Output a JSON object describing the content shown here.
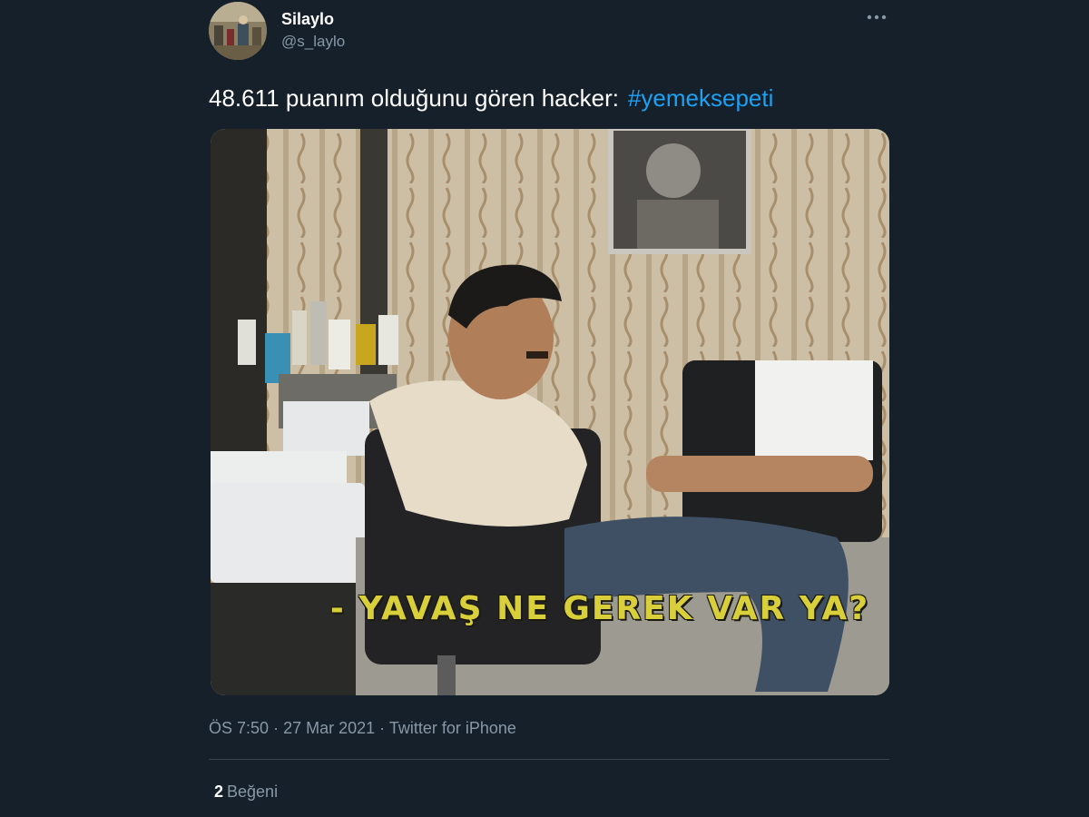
{
  "tweet": {
    "author": {
      "display_name": "Silaylo",
      "handle": "@s_laylo",
      "avatar_icon": "user-avatar-photo"
    },
    "more_icon": "more-options-icon",
    "text": "48.611 puanım olduğunu gören hacker:",
    "hashtag": "#yemeksepeti",
    "media": {
      "subtitle": "- YAVAŞ NE GEREK VAR YA?"
    },
    "meta": {
      "time": "ÖS 7:50",
      "separator1": "·",
      "date": "27 Mar 2021",
      "separator2": "·",
      "source": "Twitter for iPhone"
    },
    "stats": {
      "likes_count": "2",
      "likes_label": "Beğeni"
    }
  },
  "colors": {
    "background": "#15202b",
    "text": "#ffffff",
    "secondary_text": "#8899a6",
    "link": "#1da1f2",
    "divider": "#38444d",
    "subtitle": "#d8cf3a"
  }
}
